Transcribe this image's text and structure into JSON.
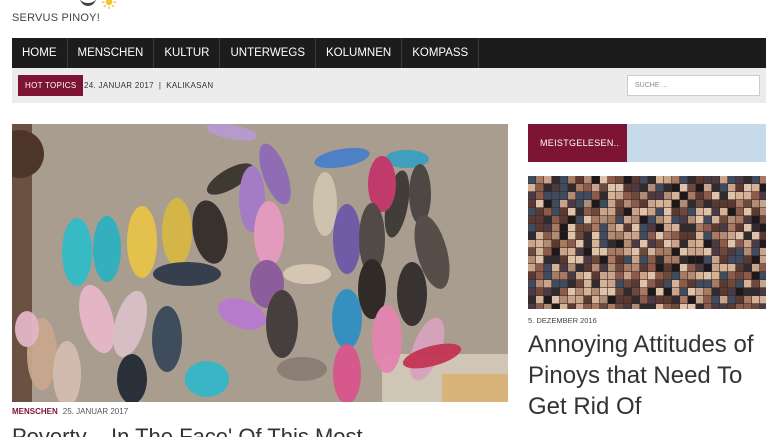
{
  "site": {
    "tagline": "SERVUS PINOY!"
  },
  "nav": {
    "items": [
      "HOME",
      "MENSCHEN",
      "KULTUR",
      "UNTERWEGS",
      "KOLUMNEN",
      "KOMPASS"
    ]
  },
  "topbar": {
    "hot_topics": "HOT TOPICS",
    "ticker_date": "24. JANUAR 2017",
    "ticker_separator": "|",
    "ticker_title": "KALIKASAN",
    "search_placeholder": "SUCHE ..."
  },
  "main_post": {
    "category": "MENSCHEN",
    "date": "25. JANUAR 2017",
    "title": "Poverty – In The Face' Of This Most"
  },
  "sidebar": {
    "tab_label": "MEISTGELESEN..",
    "post_date": "5. DEZEMBER 2016",
    "post_title": "Annoying Attitudes of Pinoys that Need To Get Rid Of"
  },
  "colors": {
    "accent": "#7d1433",
    "nav_bg": "#1c1c1c",
    "widget_bg": "#c6dae9"
  }
}
